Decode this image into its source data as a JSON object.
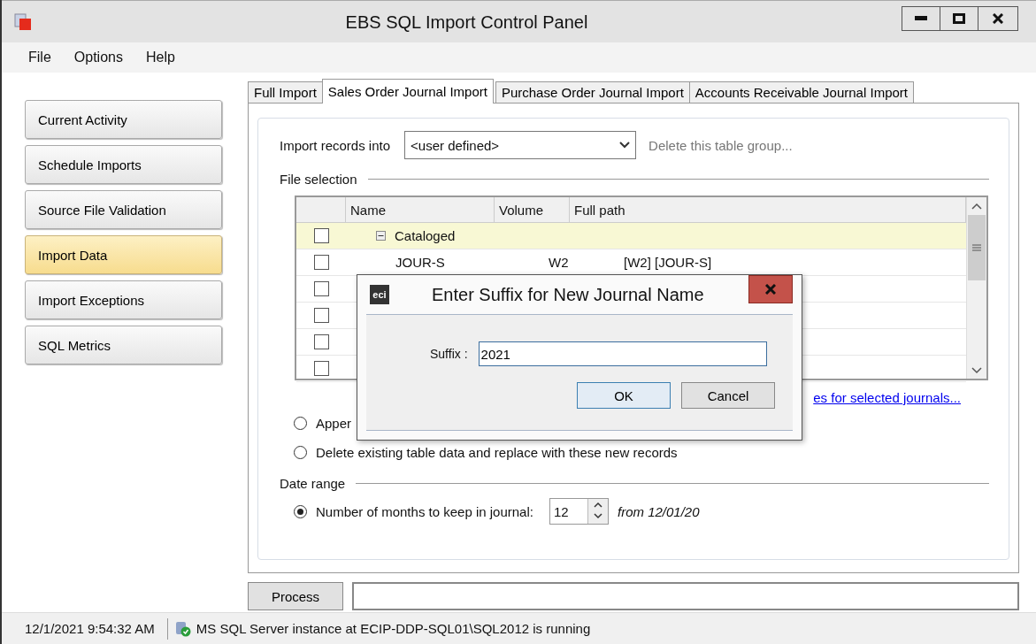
{
  "window": {
    "title": "EBS SQL Import Control Panel"
  },
  "menu": [
    "File",
    "Options",
    "Help"
  ],
  "sidebar": {
    "items": [
      {
        "label": "Current Activity",
        "selected": false
      },
      {
        "label": "Schedule Imports",
        "selected": false
      },
      {
        "label": "Source File Validation",
        "selected": false
      },
      {
        "label": "Import Data",
        "selected": true
      },
      {
        "label": "Import Exceptions",
        "selected": false
      },
      {
        "label": "SQL Metrics",
        "selected": false
      }
    ]
  },
  "tabs": [
    {
      "label": "Full Import",
      "selected": false
    },
    {
      "label": "Sales Order Journal Import",
      "selected": true
    },
    {
      "label": "Purchase Order Journal Import",
      "selected": false
    },
    {
      "label": "Accounts Receivable Journal Import",
      "selected": false
    }
  ],
  "import_into": {
    "label": "Import records into",
    "value": "<user defined>",
    "link": "Delete this table group...",
    "disabled": true
  },
  "file_selection": {
    "title": "File selection",
    "columns": [
      "Name",
      "Volume",
      "Full path"
    ],
    "rows": [
      {
        "checked": false,
        "selected": true,
        "kind": "group",
        "expanded": true,
        "name": "Cataloged"
      },
      {
        "checked": false,
        "selected": false,
        "kind": "file",
        "name": "JOUR-S",
        "volume": "W2",
        "path": "[W2] [JOUR-S]"
      },
      {
        "checked": false,
        "selected": false,
        "kind": "hidden"
      },
      {
        "checked": false,
        "selected": false,
        "kind": "hidden"
      },
      {
        "checked": false,
        "selected": false,
        "kind": "hidden"
      },
      {
        "checked": false,
        "selected": false,
        "kind": "hidden"
      }
    ],
    "link": "es for selected journals..."
  },
  "import_mode": [
    {
      "label": "Apper",
      "selected": false
    },
    {
      "label": "Delete existing table data and replace with these new records",
      "selected": false
    }
  ],
  "date_range": {
    "title": "Date range",
    "label": "Number of months to keep in journal:",
    "selected": true,
    "months": "12",
    "from": "from 12/01/20"
  },
  "process_button": "Process",
  "status_bar": {
    "time": "12/1/2021 9:54:32 AM",
    "message": "MS SQL Server instance at ECIP-DDP-SQL01\\SQL2012 is running"
  },
  "dialog": {
    "title": "Enter Suffix for New Journal Name",
    "logo": "eci",
    "field_label": "Suffix :",
    "value": "2021",
    "buttons": [
      {
        "label": "OK",
        "default": true
      },
      {
        "label": "Cancel",
        "default": false
      }
    ]
  }
}
